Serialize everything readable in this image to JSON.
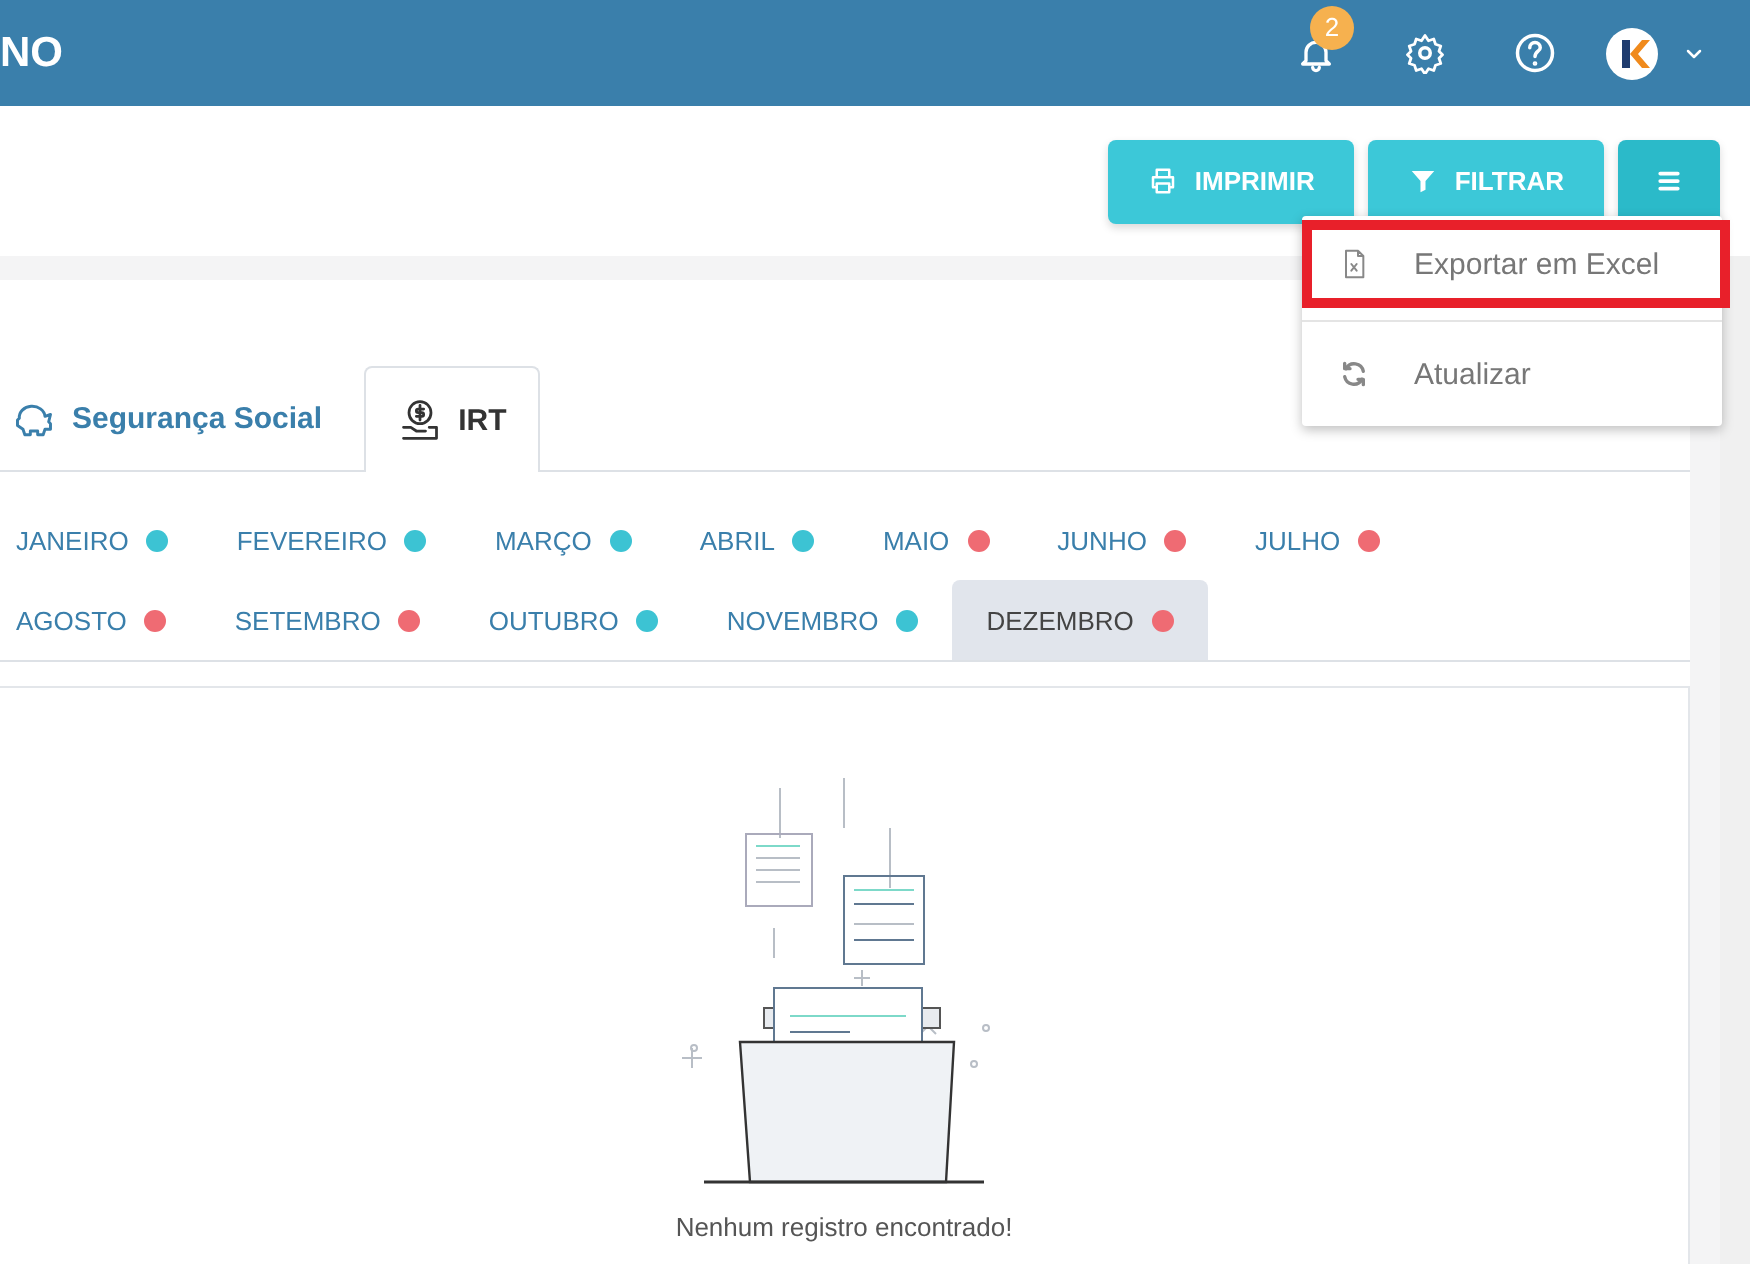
{
  "header": {
    "brand": "NO",
    "notifications": {
      "count": "2"
    }
  },
  "toolbar": {
    "buttons": [
      {
        "kind": "print",
        "label": "IMPRIMIR"
      },
      {
        "kind": "filter",
        "label": "FILTRAR"
      },
      {
        "kind": "menu"
      }
    ]
  },
  "menu": {
    "items": [
      {
        "kind": "excel",
        "label": "Exportar em Excel",
        "highlighted": true
      },
      {
        "kind": "refresh",
        "label": "Atualizar",
        "highlighted": false
      }
    ]
  },
  "tabs": [
    {
      "kind": "piggy",
      "label": "Segurança Social",
      "selected": false
    },
    {
      "kind": "coin",
      "label": "IRT",
      "selected": true
    }
  ],
  "month_rows": [
    [
      {
        "label": "JANEIRO",
        "color": "#3cc3d3",
        "selected": false
      },
      {
        "label": "FEVEREIRO",
        "color": "#3cc3d3",
        "selected": false
      },
      {
        "label": "MARÇO",
        "color": "#3cc3d3",
        "selected": false
      },
      {
        "label": "ABRIL",
        "color": "#3cc3d3",
        "selected": false
      },
      {
        "label": "MAIO",
        "color": "#ef6b73",
        "selected": false
      },
      {
        "label": "JUNHO",
        "color": "#ef6b73",
        "selected": false
      },
      {
        "label": "JULHO",
        "color": "#ef6b73",
        "selected": false
      }
    ],
    [
      {
        "label": "AGOSTO",
        "color": "#ef6b73",
        "selected": false
      },
      {
        "label": "SETEMBRO",
        "color": "#ef6b73",
        "selected": false
      },
      {
        "label": "OUTUBRO",
        "color": "#3cc3d3",
        "selected": false
      },
      {
        "label": "NOVEMBRO",
        "color": "#3cc3d3",
        "selected": false
      },
      {
        "label": "DEZEMBRO",
        "color": "#ef6b73",
        "selected": true
      }
    ]
  ],
  "empty_state": {
    "message": "Nenhum registro encontrado!"
  }
}
